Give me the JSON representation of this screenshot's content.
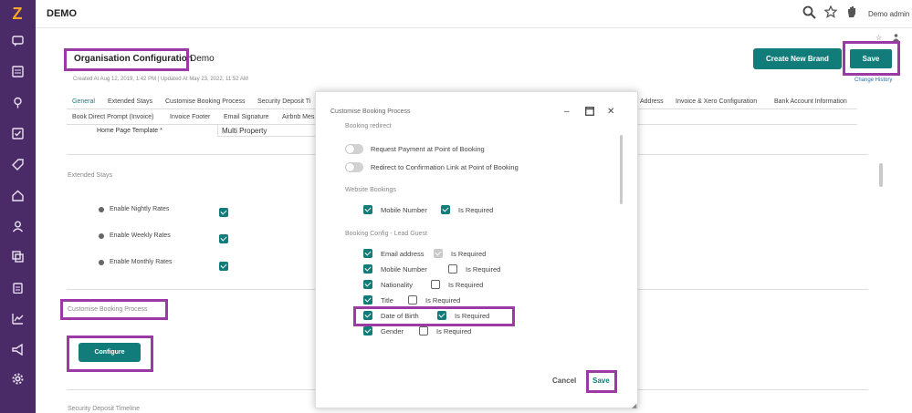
{
  "app": {
    "title": "DEMO",
    "user": "Demo admin"
  },
  "sidebar": {
    "logo": "Z",
    "icons": [
      "chat-icon",
      "list-icon",
      "map-pin-icon",
      "check-icon",
      "tag-icon",
      "home-icon",
      "user-icon",
      "copy-icon",
      "clipboard-icon",
      "chart-icon",
      "megaphone-icon",
      "gear-icon"
    ]
  },
  "header": {
    "title": "Organisation Configuration",
    "subtitle": "Demo",
    "meta": "Created At Aug 12, 2019, 1:42 PM  |  Updated At May 23, 2022, 11:52 AM",
    "create_brand_label": "Create New Brand",
    "save_label": "Save",
    "change_history": "Change History"
  },
  "tabs_row1": [
    "General",
    "Extended Stays",
    "Customise Booking Process",
    "Security Deposit Ti",
    "Address",
    "Invoice & Xero Configuration",
    "Bank Account Information"
  ],
  "tabs_row2": [
    "Book Direct Prompt (Invoice)",
    "Invoice Footer",
    "Email Signature",
    "Airbnb Mes"
  ],
  "form": {
    "home_page_label": "Home Page Template *",
    "home_page_value": "Multi Property",
    "extended_stays_title": "Extended Stays",
    "rates": [
      "Enable Nightly Rates",
      "Enable Weekly Rates",
      "Enable Monthly Rates"
    ],
    "customise_title": "Customise Booking Process",
    "configure_label": "Configure",
    "security_title": "Security Deposit Timeline"
  },
  "modal": {
    "title": "Customise Booking Process",
    "booking_redirect": "Booking redirect",
    "toggles": [
      "Request Payment at Point of Booking",
      "Redirect to Confirmation Link at Point of Booking"
    ],
    "website_bookings": "Website Bookings",
    "mobile_number": "Mobile Number",
    "is_required": "Is Required",
    "lead_guest_title": "Booking Config - Lead Guest",
    "lead_fields": [
      "Email address",
      "Mobile Number",
      "Nationality",
      "Title",
      "Date of Birth",
      "Gender"
    ],
    "lead_required": [
      "disabled",
      "off",
      "off",
      "off",
      "on",
      "off"
    ],
    "cancel_label": "Cancel",
    "save_label": "Save"
  },
  "colors": {
    "sidebar": "#4a2b67",
    "accent": "#127c7a",
    "highlight": "#9b3aa5"
  }
}
